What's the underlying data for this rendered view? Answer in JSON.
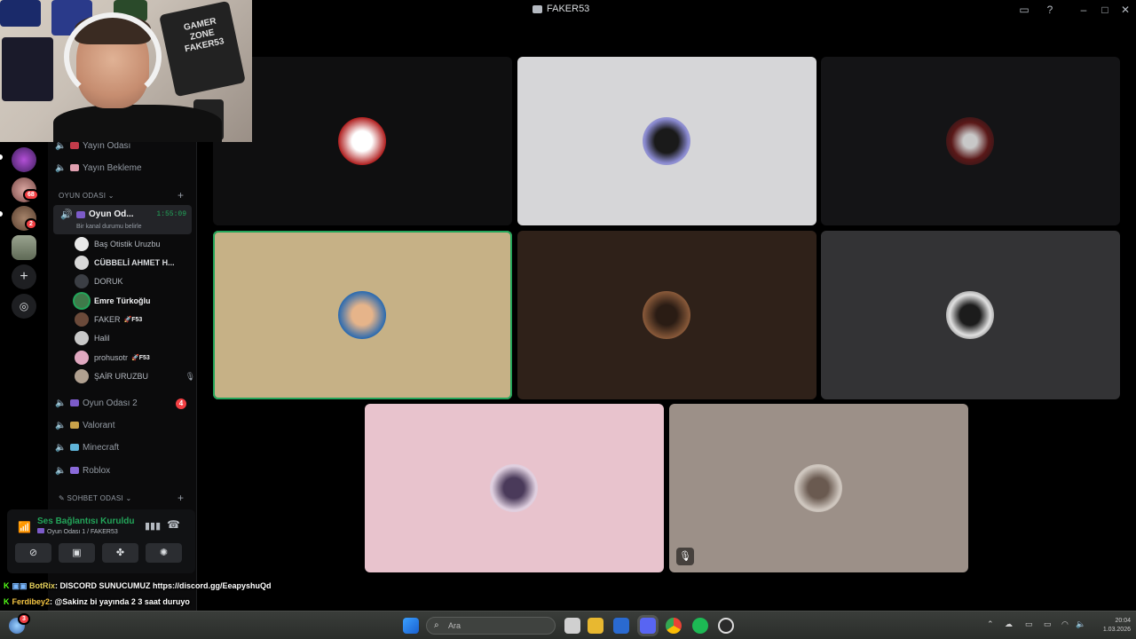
{
  "window": {
    "title": "FAKER53"
  },
  "channels": {
    "top_items": [
      "Yayın Odası",
      "Yayın Bekleme"
    ],
    "category_game": "OYUN ODASI",
    "active_channel": {
      "name": "Oyun Od...",
      "timer": "1:55:09",
      "status_hint": "Bir kanal durumu belirle"
    },
    "members": [
      {
        "name": "Baş Otistik Uruzbu",
        "tag": ""
      },
      {
        "name": "CÜBBELİ AHMET H...",
        "tag": ""
      },
      {
        "name": "DORUK",
        "tag": ""
      },
      {
        "name": "Emre Türkoğlu",
        "tag": ""
      },
      {
        "name": "FAKER",
        "tag": "F53"
      },
      {
        "name": "Halil",
        "tag": ""
      },
      {
        "name": "prohusotr",
        "tag": "F53"
      },
      {
        "name": "ŞAİR URUZBU",
        "tag": ""
      }
    ],
    "other_channels": [
      {
        "name": "Oyun Odası 2",
        "badge": "4"
      },
      {
        "name": "Valorant",
        "badge": ""
      },
      {
        "name": "Minecraft",
        "badge": ""
      },
      {
        "name": "Roblox",
        "badge": ""
      }
    ],
    "category_chat": "SOHBET ODASI"
  },
  "server_rail": {
    "badges": [
      "68",
      "2"
    ]
  },
  "voice_panel": {
    "title": "Ses Bağlantısı Kuruldu",
    "subtitle": "Oyun Odası 1 / FAKER53"
  },
  "webcam": {
    "logo_text": "GAMER ZONE FAKER53"
  },
  "chat": [
    {
      "user": "BotRix",
      "text": ": DISCORD SUNUCUMUZ https://discord.gg/EeapyshuQd"
    },
    {
      "user": "Ferdibey2",
      "text": ": @Sakinz bi yayında 2 3 saat duruyo"
    }
  ],
  "taskbar": {
    "search_placeholder": "Ara",
    "time": "20:04",
    "date": "1.03.2026",
    "notif_count": "3"
  },
  "colors": {
    "accent_green": "#23a55a",
    "danger": "#f23f43",
    "kick_green": "#53fc18"
  }
}
